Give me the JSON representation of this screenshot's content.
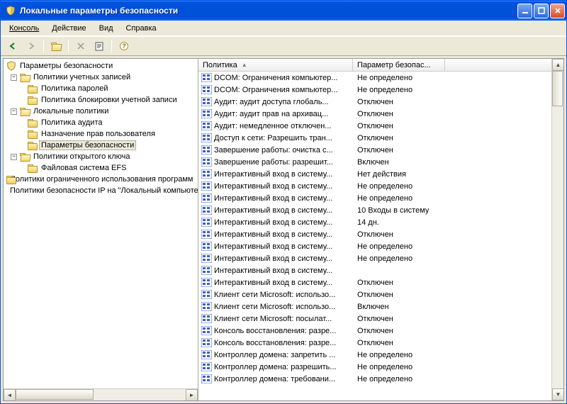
{
  "window": {
    "title": "Локальные параметры безопасности"
  },
  "menu": {
    "console": "Консоль",
    "action": "Действие",
    "view": "Вид",
    "help": "Справка"
  },
  "tree": {
    "root": "Параметры безопасности",
    "accountPolicies": "Политики учетных записей",
    "passwordPolicy": "Политика паролей",
    "lockoutPolicy": "Политика блокировки учетной записи",
    "localPolicies": "Локальные политики",
    "auditPolicy": "Политика аудита",
    "userRights": "Назначение прав пользователя",
    "securityOptions": "Параметры безопасности",
    "publicKey": "Политики открытого ключа",
    "efs": "Файловая система EFS",
    "softwareRestriction": "Политики ограниченного использования программ",
    "ipsec": "Политики безопасности IP на \"Локальный компьютер\""
  },
  "columns": {
    "policy": "Политика",
    "setting": "Параметр безопас..."
  },
  "rows": [
    {
      "name": "DCOM: Ограничения компьютер...",
      "val": "Не определено"
    },
    {
      "name": "DCOM: Ограничения компьютер...",
      "val": "Не определено"
    },
    {
      "name": "Аудит: аудит доступа глобаль...",
      "val": "Отключен"
    },
    {
      "name": "Аудит: аудит прав на архивац...",
      "val": "Отключен"
    },
    {
      "name": "Аудит: немедленное отключен...",
      "val": "Отключен"
    },
    {
      "name": "Доступ к сети: Разрешить тран...",
      "val": "Отключен"
    },
    {
      "name": "Завершение работы: очистка с...",
      "val": "Отключен"
    },
    {
      "name": "Завершение работы: разрешит...",
      "val": "Включен"
    },
    {
      "name": "Интерактивный вход в систему...",
      "val": "Нет действия"
    },
    {
      "name": "Интерактивный вход в систему...",
      "val": "Не определено"
    },
    {
      "name": "Интерактивный вход в систему...",
      "val": "Не определено"
    },
    {
      "name": "Интерактивный вход в систему...",
      "val": "10 Входы в систему"
    },
    {
      "name": "Интерактивный вход в систему...",
      "val": "14 дн."
    },
    {
      "name": "Интерактивный вход в систему...",
      "val": "Отключен"
    },
    {
      "name": "Интерактивный вход в систему...",
      "val": "Не определено"
    },
    {
      "name": "Интерактивный вход в систему...",
      "val": "Не определено"
    },
    {
      "name": "Интерактивный вход в систему...",
      "val": ""
    },
    {
      "name": "Интерактивный вход в систему...",
      "val": "Отключен"
    },
    {
      "name": "Клиент сети Microsoft: использо...",
      "val": "Отключен"
    },
    {
      "name": "Клиент сети Microsoft: использо...",
      "val": "Включен"
    },
    {
      "name": "Клиент сети Microsoft: посылат...",
      "val": "Отключен"
    },
    {
      "name": "Консоль восстановления: разре...",
      "val": "Отключен"
    },
    {
      "name": "Консоль восстановления: разре...",
      "val": "Отключен"
    },
    {
      "name": "Контроллер домена: запретить ...",
      "val": "Не определено"
    },
    {
      "name": "Контроллер домена: разрешить...",
      "val": "Не определено"
    },
    {
      "name": "Контроллер домена: требовани...",
      "val": "Не определено"
    }
  ]
}
